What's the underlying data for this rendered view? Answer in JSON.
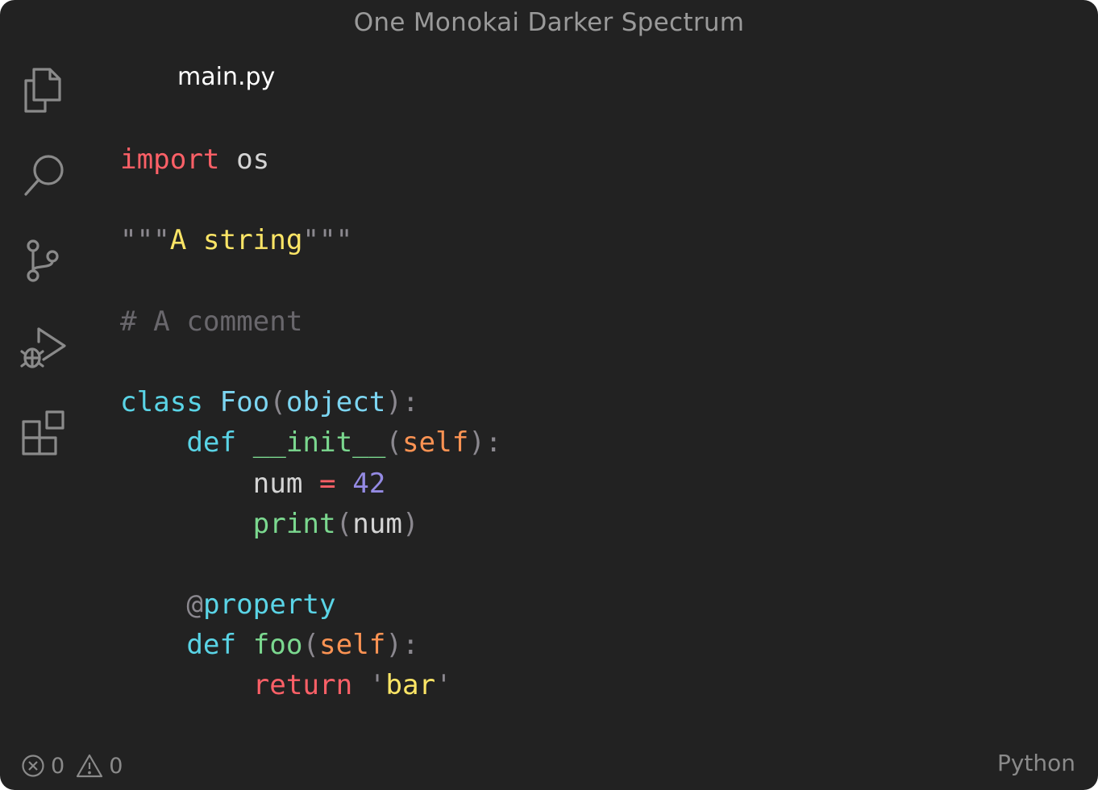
{
  "window": {
    "title": "One Monokai Darker Spectrum",
    "background": "#222222"
  },
  "activity_bar": {
    "icons": [
      "files-icon",
      "search-icon",
      "source-control-icon",
      "run-debug-icon",
      "extensions-icon"
    ]
  },
  "editor": {
    "tab_label": "main.py",
    "lines": [
      {
        "tokens": [
          {
            "t": "import",
            "c": "#fc6067"
          },
          {
            "t": " os",
            "c": "#d4d4d4"
          }
        ]
      },
      {
        "tokens": []
      },
      {
        "tokens": [
          {
            "t": "\"\"\"",
            "c": "#8b888f"
          },
          {
            "t": "A string",
            "c": "#fce566"
          },
          {
            "t": "\"\"\"",
            "c": "#8b888f"
          }
        ]
      },
      {
        "tokens": []
      },
      {
        "tokens": [
          {
            "t": "# A comment",
            "c": "#69676c"
          }
        ]
      },
      {
        "tokens": []
      },
      {
        "tokens": [
          {
            "t": "class",
            "c": "#5ad4e6"
          },
          {
            "t": " ",
            "c": "#d4d4d4"
          },
          {
            "t": "Foo",
            "c": "#7cd5f1"
          },
          {
            "t": "(",
            "c": "#8b888f"
          },
          {
            "t": "object",
            "c": "#7cd5f1"
          },
          {
            "t": "):",
            "c": "#8b888f"
          }
        ]
      },
      {
        "tokens": [
          {
            "t": "    ",
            "c": "#d4d4d4"
          },
          {
            "t": "def",
            "c": "#5ad4e6"
          },
          {
            "t": " ",
            "c": "#d4d4d4"
          },
          {
            "t": "__init__",
            "c": "#7bd88f"
          },
          {
            "t": "(",
            "c": "#8b888f"
          },
          {
            "t": "self",
            "c": "#fd9353"
          },
          {
            "t": "):",
            "c": "#8b888f"
          }
        ]
      },
      {
        "tokens": [
          {
            "t": "        num ",
            "c": "#d4d4d4"
          },
          {
            "t": "=",
            "c": "#fc6067"
          },
          {
            "t": " ",
            "c": "#d4d4d4"
          },
          {
            "t": "42",
            "c": "#948ae3"
          }
        ]
      },
      {
        "tokens": [
          {
            "t": "        ",
            "c": "#d4d4d4"
          },
          {
            "t": "print",
            "c": "#7bd88f"
          },
          {
            "t": "(",
            "c": "#8b888f"
          },
          {
            "t": "num",
            "c": "#d4d4d4"
          },
          {
            "t": ")",
            "c": "#8b888f"
          }
        ]
      },
      {
        "tokens": []
      },
      {
        "tokens": [
          {
            "t": "    ",
            "c": "#d4d4d4"
          },
          {
            "t": "@",
            "c": "#8b888f"
          },
          {
            "t": "property",
            "c": "#5ad4e6"
          }
        ]
      },
      {
        "tokens": [
          {
            "t": "    ",
            "c": "#d4d4d4"
          },
          {
            "t": "def",
            "c": "#5ad4e6"
          },
          {
            "t": " ",
            "c": "#d4d4d4"
          },
          {
            "t": "foo",
            "c": "#7bd88f"
          },
          {
            "t": "(",
            "c": "#8b888f"
          },
          {
            "t": "self",
            "c": "#fd9353"
          },
          {
            "t": "):",
            "c": "#8b888f"
          }
        ]
      },
      {
        "tokens": [
          {
            "t": "        ",
            "c": "#d4d4d4"
          },
          {
            "t": "return",
            "c": "#fc6067"
          },
          {
            "t": " ",
            "c": "#d4d4d4"
          },
          {
            "t": "'",
            "c": "#8b888f"
          },
          {
            "t": "bar",
            "c": "#fce566"
          },
          {
            "t": "'",
            "c": "#8b888f"
          }
        ]
      }
    ]
  },
  "status_bar": {
    "errors": "0",
    "warnings": "0",
    "language": "Python"
  }
}
